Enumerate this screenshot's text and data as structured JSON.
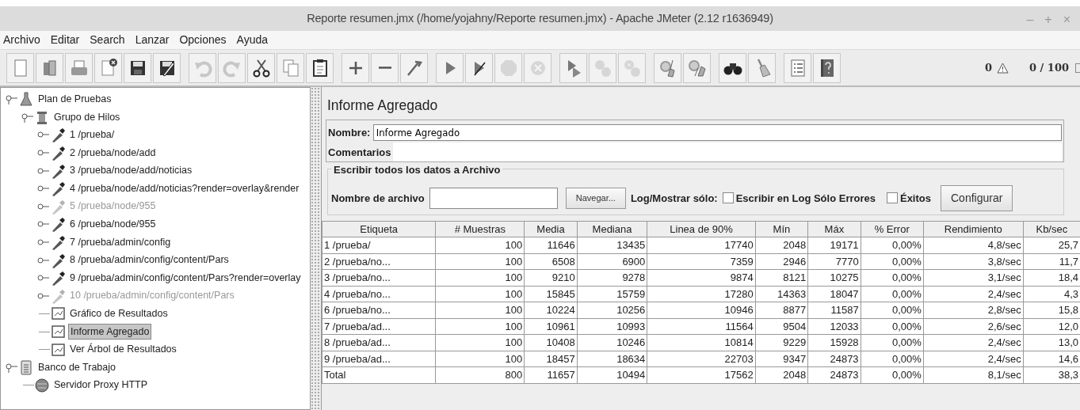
{
  "window": {
    "title": "Reporte resumen.jmx (/home/yojahny/Reporte resumen.jmx) - Apache JMeter (2.12 r1636949)",
    "controls": [
      "–",
      "+",
      "×"
    ]
  },
  "menu": [
    {
      "label": "Archivo"
    },
    {
      "label": "Editar"
    },
    {
      "label": "Search"
    },
    {
      "label": "Lanzar"
    },
    {
      "label": "Opciones"
    },
    {
      "label": "Ayuda"
    }
  ],
  "toolbar": {
    "groups": [
      [
        {
          "disabled": false
        },
        {
          "disabled": false
        },
        {
          "disabled": false
        },
        {
          "disabled": false
        },
        {
          "disabled": false
        },
        {
          "disabled": false
        }
      ],
      [
        {
          "disabled": true
        },
        {
          "disabled": true
        },
        {
          "disabled": false
        },
        {
          "disabled": false
        },
        {
          "disabled": false
        }
      ],
      [
        {
          "disabled": false
        },
        {
          "disabled": false
        },
        {
          "disabled": false
        }
      ],
      [
        {
          "disabled": false
        },
        {
          "disabled": false
        },
        {
          "disabled": true
        },
        {
          "disabled": true
        }
      ],
      [
        {
          "disabled": false
        },
        {
          "disabled": true
        },
        {
          "disabled": true
        }
      ],
      [
        {
          "disabled": false
        },
        {
          "disabled": false
        }
      ],
      [
        {
          "disabled": false
        },
        {
          "disabled": false
        }
      ],
      [
        {
          "disabled": false
        },
        {
          "disabled": false
        }
      ]
    ],
    "warnings": "0",
    "threads": "0 / 100"
  },
  "tree": [
    {
      "label": "Plan de Pruebas",
      "kind": "plan",
      "expanded": true,
      "selected": false,
      "disabled": false,
      "children": [
        {
          "label": "Grupo de Hilos",
          "kind": "threads",
          "expanded": true,
          "selected": false,
          "disabled": false,
          "children": [
            {
              "label": "1 /prueba/",
              "kind": "sampler",
              "expanded": false,
              "selected": false,
              "disabled": false
            },
            {
              "label": "2 /prueba/node/add",
              "kind": "sampler",
              "expanded": false,
              "selected": false,
              "disabled": false
            },
            {
              "label": "3 /prueba/node/add/noticias",
              "kind": "sampler",
              "expanded": false,
              "selected": false,
              "disabled": false
            },
            {
              "label": "4 /prueba/node/add/noticias?render=overlay&render",
              "kind": "sampler",
              "expanded": false,
              "selected": false,
              "disabled": false
            },
            {
              "label": "5 /prueba/node/955",
              "kind": "sampler",
              "expanded": false,
              "selected": false,
              "disabled": true
            },
            {
              "label": "6 /prueba/node/955",
              "kind": "sampler",
              "expanded": false,
              "selected": false,
              "disabled": false
            },
            {
              "label": "7 /prueba/admin/config",
              "kind": "sampler",
              "expanded": false,
              "selected": false,
              "disabled": false
            },
            {
              "label": "8 /prueba/admin/config/content/Pars",
              "kind": "sampler",
              "expanded": false,
              "selected": false,
              "disabled": false
            },
            {
              "label": "9 /prueba/admin/config/content/Pars?render=overlay",
              "kind": "sampler",
              "expanded": false,
              "selected": false,
              "disabled": false
            },
            {
              "label": "10 /prueba/admin/config/content/Pars",
              "kind": "sampler",
              "expanded": false,
              "selected": false,
              "disabled": true
            },
            {
              "label": "Gráfico de Resultados",
              "kind": "listener",
              "selected": false,
              "disabled": false
            },
            {
              "label": "Informe Agregado",
              "kind": "listener",
              "selected": true,
              "disabled": false
            },
            {
              "label": "Ver Árbol de Resultados",
              "kind": "listener",
              "selected": false,
              "disabled": false
            }
          ]
        }
      ]
    },
    {
      "label": "Banco de Trabajo",
      "kind": "workbench",
      "expanded": true,
      "selected": false,
      "disabled": false,
      "children": [
        {
          "label": "Servidor Proxy HTTP",
          "kind": "proxy",
          "selected": false,
          "disabled": false
        }
      ]
    }
  ],
  "panel": {
    "title": "Informe Agregado",
    "name_label": "Nombre:",
    "name_value": "Informe Agregado",
    "comments_label": "Comentarios",
    "file_group": {
      "legend": "Escribir todos los datos a Archivo",
      "file_label": "Nombre de archivo",
      "browse": "Navegar...",
      "log_label": "Log/Mostrar sólo:",
      "checks": [
        {
          "label": "Escribir en Log Sólo Errores",
          "checked": false
        },
        {
          "label": "Éxitos",
          "checked": false
        }
      ],
      "configure": "Configurar"
    }
  },
  "table": {
    "columns": [
      "Etiqueta",
      "# Muestras",
      "Media",
      "Mediana",
      "Linea de 90%",
      "Mín",
      "Máx",
      "% Error",
      "Rendimiento",
      "Kb/sec"
    ],
    "rows": [
      [
        "1 /prueba/",
        "100",
        "11646",
        "13435",
        "17740",
        "2048",
        "19171",
        "0,00%",
        "4,8/sec",
        "25,7"
      ],
      [
        "2 /prueba/no...",
        "100",
        "6508",
        "6900",
        "7359",
        "2946",
        "7770",
        "0,00%",
        "3,8/sec",
        "11,7"
      ],
      [
        "3 /prueba/no...",
        "100",
        "9210",
        "9278",
        "9874",
        "8121",
        "10275",
        "0,00%",
        "3,1/sec",
        "18,4"
      ],
      [
        "4 /prueba/no...",
        "100",
        "15845",
        "15759",
        "17280",
        "14363",
        "18047",
        "0,00%",
        "2,4/sec",
        "4,3"
      ],
      [
        "6 /prueba/no...",
        "100",
        "10224",
        "10256",
        "10946",
        "8877",
        "11587",
        "0,00%",
        "2,8/sec",
        "15,8"
      ],
      [
        "7 /prueba/ad...",
        "100",
        "10961",
        "10993",
        "11564",
        "9504",
        "12033",
        "0,00%",
        "2,6/sec",
        "12,0"
      ],
      [
        "8 /prueba/ad...",
        "100",
        "10408",
        "10246",
        "10814",
        "9229",
        "15928",
        "0,00%",
        "2,4/sec",
        "13,0"
      ],
      [
        "9 /prueba/ad...",
        "100",
        "18457",
        "18634",
        "22703",
        "9347",
        "24873",
        "0,00%",
        "2,4/sec",
        "14,6"
      ],
      [
        "Total",
        "800",
        "11657",
        "10494",
        "17562",
        "2048",
        "24873",
        "0,00%",
        "8,1/sec",
        "38,3"
      ]
    ]
  }
}
